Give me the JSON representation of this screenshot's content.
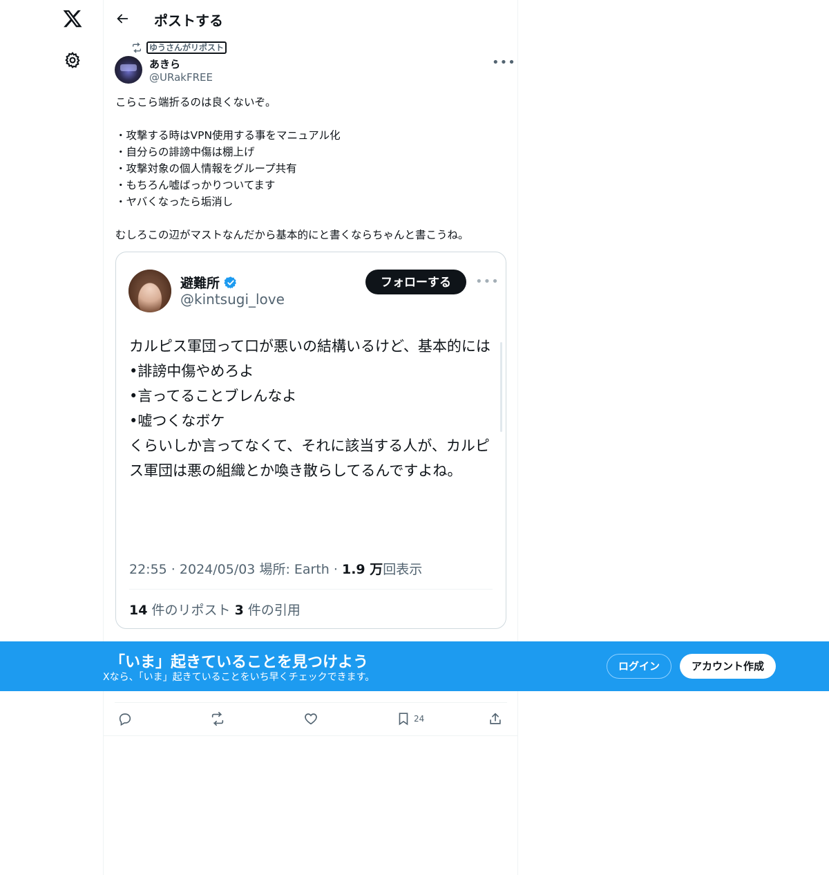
{
  "header": {
    "title": "ポストする"
  },
  "repost": {
    "label": "ゆうさんがリポスト"
  },
  "post": {
    "author_name": "あきら",
    "author_handle": "@URakFREE",
    "body_lines": [
      "こらこら端折るのは良くないぞ。",
      "",
      "・攻撃する時はVPN使用する事をマニュアル化",
      "・自分らの誹謗中傷は棚上げ",
      "・攻撃対象の個人情報をグループ共有",
      "・もちろん嘘ばっかりついてます",
      "・ヤバくなったら垢消し",
      "",
      "むしろこの辺がマストなんだから基本的にと書くならちゃんと書こうね。"
    ]
  },
  "quote": {
    "author_name": "避難所",
    "author_handle": "@kintsugi_love",
    "follow_label": "フォローする",
    "body_lines": [
      "カルピス軍団って口が悪いの結構いるけど、基本的には",
      "•誹謗中傷やめろよ",
      "•言ってることブレんなよ",
      "•嘘つくなボケ",
      "くらいしか言ってなくて、それに該当する人が、カルピス軍団は悪の組織とか喚き散らしてるんですよね。"
    ],
    "time": "22:55",
    "date": "2024/05/03",
    "location": "場所: Earth",
    "views_count": "1.9 万",
    "views_label": "回表示",
    "reposts_count": "14",
    "reposts_label": "件のリポスト",
    "quotes_count": "3",
    "quotes_label": "件の引用"
  },
  "actions": {
    "bookmark_count": "24"
  },
  "banner": {
    "title": "「いま」起きていることを見つけよう",
    "subtitle": "Xなら、「いま」起きていることをいち早くチェックできます。",
    "login_label": "ログイン",
    "signup_label": "アカウント作成"
  },
  "colors": {
    "brand_blue": "#1d9bf0",
    "text": "#0f1419",
    "muted": "#536471"
  },
  "icons": [
    "x-logo-icon",
    "gear-icon",
    "back-arrow-icon",
    "repost-icon",
    "more-icon",
    "verified-icon",
    "reply-icon",
    "like-icon",
    "bookmark-icon",
    "share-icon"
  ]
}
